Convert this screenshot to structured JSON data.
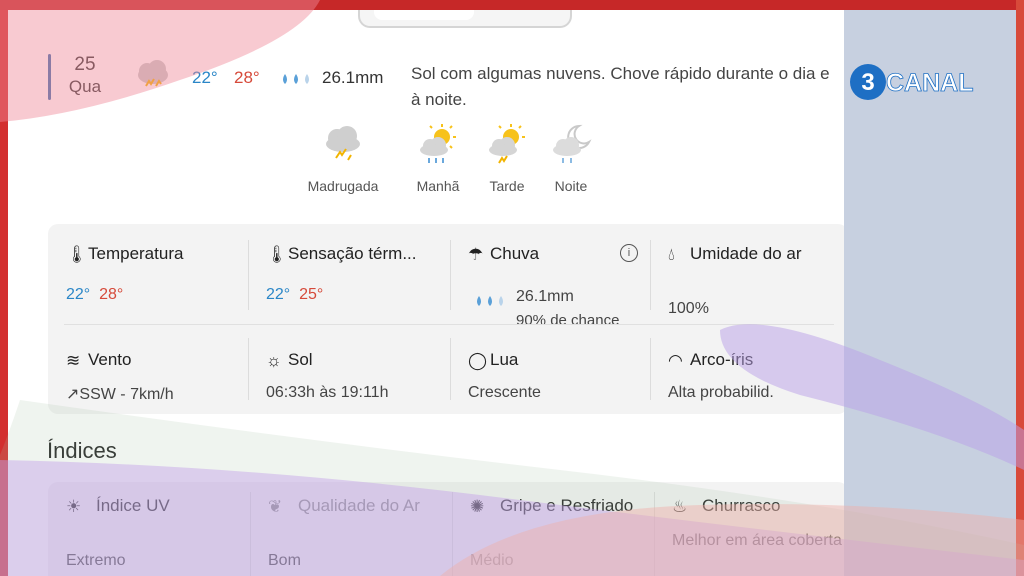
{
  "day": {
    "number": "25",
    "weekday": "Qua",
    "temp_min": "22°",
    "temp_max": "28°",
    "rain_mm": "26.1mm",
    "summary": "Sol com algumas nuvens. Chove rápido durante o dia e à noite."
  },
  "periods": [
    {
      "label": "Madrugada",
      "icon": "storm-cloud-icon"
    },
    {
      "label": "Manhã",
      "icon": "sun-cloud-rain-icon"
    },
    {
      "label": "Tarde",
      "icon": "sun-cloud-storm-icon"
    },
    {
      "label": "Noite",
      "icon": "moon-cloud-rain-icon"
    }
  ],
  "details": {
    "temperatura": {
      "title": "Temperatura",
      "min": "22°",
      "max": "28°"
    },
    "sensacao": {
      "title": "Sensação térm...",
      "min": "22°",
      "max": "25°"
    },
    "chuva": {
      "title": "Chuva",
      "mm": "26.1mm",
      "chance": "90% de chance"
    },
    "umidade": {
      "title": "Umidade do ar",
      "value": "100%"
    },
    "vento": {
      "title": "Vento",
      "value": "SSW - 7km/h"
    },
    "sol": {
      "title": "Sol",
      "value": "06:33h às 19:11h"
    },
    "lua": {
      "title": "Lua",
      "value": "Crescente"
    },
    "arco_iris": {
      "title": "Arco-íris",
      "value": "Alta probabilid."
    }
  },
  "indices": {
    "title": "Índices",
    "items": [
      {
        "title": "Índice UV",
        "value": "Extremo"
      },
      {
        "title": "Qualidade do Ar",
        "value": "Bom"
      },
      {
        "title": "Gripe e Resfriado",
        "value": "Médio"
      },
      {
        "title": "Churrasco",
        "value": "Melhor em área coberta"
      }
    ]
  },
  "logo": {
    "text": "CANAL",
    "digit": "3"
  },
  "colors": {
    "min_temp": "#2a86c7",
    "max_temp": "#d64a3a",
    "frame": "#d32f2f",
    "side_panel": "#c7d0e0"
  }
}
